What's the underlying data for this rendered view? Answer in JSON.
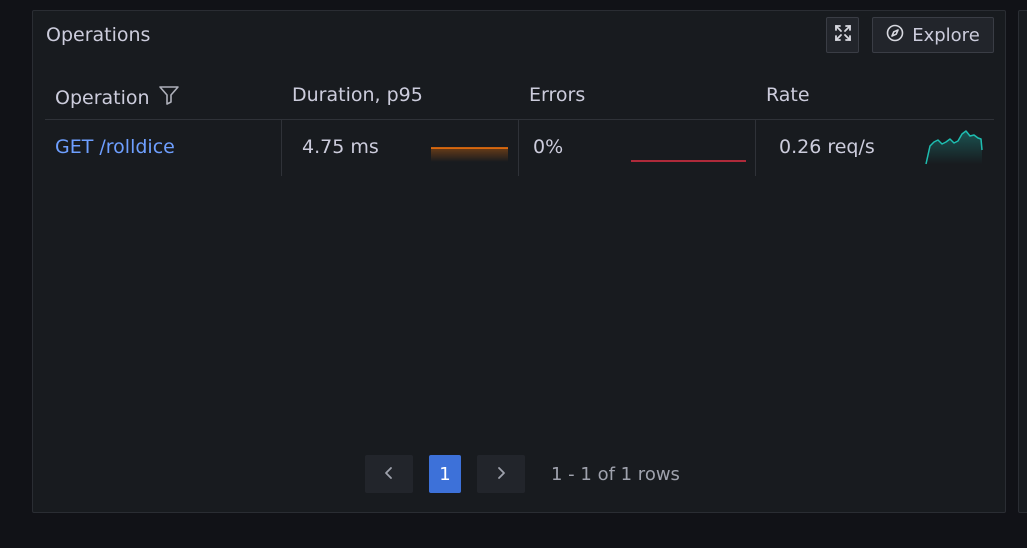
{
  "panel": {
    "title": "Operations",
    "explore_label": "Explore",
    "icons": {
      "expand": "expand-icon",
      "explore": "compass-icon",
      "filter": "filter-icon"
    }
  },
  "table": {
    "headers": {
      "operation": "Operation",
      "duration": "Duration, p95",
      "errors": "Errors",
      "rate": "Rate"
    },
    "rows": [
      {
        "operation": "GET /rolldice",
        "duration": "4.75 ms",
        "errors": "0%",
        "rate": "0.26 req/s"
      }
    ]
  },
  "pagination": {
    "current_page": "1",
    "info": "1 - 1 of 1 rows"
  },
  "colors": {
    "link": "#6e9fff",
    "duration_spark": "#ff780a",
    "errors_spark": "#e02f44",
    "rate_spark": "#1ebdb0",
    "page_active": "#3d71d9"
  }
}
